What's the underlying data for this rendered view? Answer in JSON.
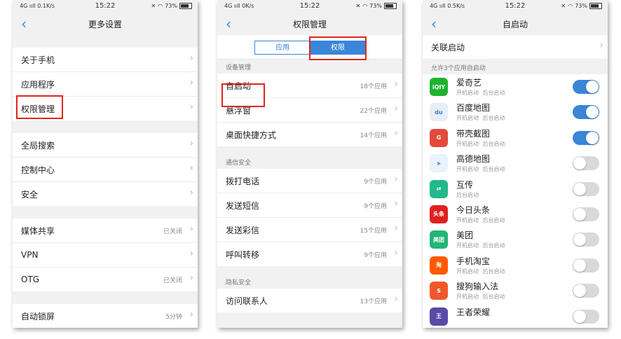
{
  "colors": {
    "accent": "#3a86d8",
    "highlight": "#e1251b"
  },
  "phone1": {
    "status": {
      "left": "4G ııll  0.1K/s",
      "time": "15:22",
      "right": "73%"
    },
    "title": "更多设置",
    "group1": [
      {
        "label": "关于手机"
      },
      {
        "label": "应用程序"
      },
      {
        "label": "权限管理"
      }
    ],
    "group2": [
      {
        "label": "全局搜索"
      },
      {
        "label": "控制中心"
      },
      {
        "label": "安全"
      }
    ],
    "group3": [
      {
        "label": "媒体共享",
        "value": "已关闭"
      },
      {
        "label": "VPN"
      },
      {
        "label": "OTG",
        "value": "已关闭"
      }
    ],
    "group4": [
      {
        "label": "自动锁屏",
        "value": "5分钟"
      }
    ]
  },
  "phone2": {
    "status": {
      "left": "4G ııll  0K/s",
      "time": "15:22",
      "right": "73%"
    },
    "title": "权限管理",
    "tabs": {
      "a": "应用",
      "b": "权限"
    },
    "section1": "设备管理",
    "device": [
      {
        "label": "自启动",
        "value": "18个应用"
      },
      {
        "label": "悬浮窗",
        "value": "22个应用"
      },
      {
        "label": "桌面快捷方式",
        "value": "14个应用"
      }
    ],
    "section2": "通信安全",
    "comm": [
      {
        "label": "拨打电话",
        "value": "9个应用"
      },
      {
        "label": "发送短信",
        "value": "9个应用"
      },
      {
        "label": "发送彩信",
        "value": "15个应用"
      },
      {
        "label": "呼叫转移",
        "value": "9个应用"
      }
    ],
    "section3": "隐私安全",
    "privacy": [
      {
        "label": "访问联系人",
        "value": "13个应用"
      }
    ]
  },
  "phone3": {
    "status": {
      "left": "4G ııll  0.5K/s",
      "time": "15:22",
      "right": "73%"
    },
    "title": "自启动",
    "related": "关联启动",
    "section": "允许3个应用自启动",
    "apps": [
      {
        "name": "爱奇艺",
        "sub": "开机启动 后台启动",
        "on": true,
        "icon": "iqiyi-icon",
        "color": "#1fb32e",
        "glyph": "iQIY"
      },
      {
        "name": "百度地图",
        "sub": "开机启动 后台启动",
        "on": true,
        "icon": "baidu-map-icon",
        "color": "#e8eef5",
        "glyph": "du"
      },
      {
        "name": "带壳截图",
        "sub": "开机启动 后台启动",
        "on": true,
        "icon": "screenshot-icon",
        "color": "#e24a3a",
        "glyph": "G"
      },
      {
        "name": "高德地图",
        "sub": "开机启动 后台启动",
        "on": false,
        "icon": "amap-icon",
        "color": "#e8f3fb",
        "glyph": "➤"
      },
      {
        "name": "互传",
        "sub": "后台启动",
        "on": false,
        "icon": "share-icon",
        "color": "#23b98a",
        "glyph": "⇄"
      },
      {
        "name": "今日头条",
        "sub": "开机启动 后台启动",
        "on": false,
        "icon": "toutiao-icon",
        "color": "#e0201c",
        "glyph": "头条"
      },
      {
        "name": "美团",
        "sub": "开机启动 后台启动",
        "on": false,
        "icon": "meituan-icon",
        "color": "#22b573",
        "glyph": "美团"
      },
      {
        "name": "手机淘宝",
        "sub": "开机启动 后台启动",
        "on": false,
        "icon": "taobao-icon",
        "color": "#ff5a00",
        "glyph": "淘"
      },
      {
        "name": "搜狗输入法",
        "sub": "开机启动 后台启动",
        "on": false,
        "icon": "sogou-icon",
        "color": "#f0582b",
        "glyph": "S"
      },
      {
        "name": "王者荣耀",
        "sub": "",
        "on": false,
        "icon": "honor-of-kings-icon",
        "color": "#5a4aa8",
        "glyph": "王"
      }
    ]
  }
}
